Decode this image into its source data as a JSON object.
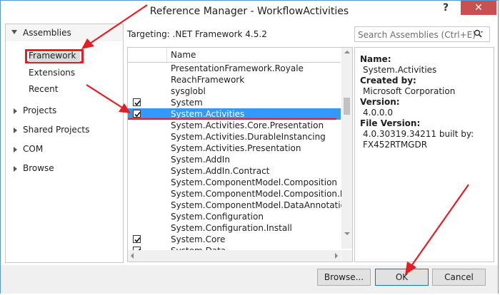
{
  "window": {
    "title": "Reference Manager - WorkflowActivities"
  },
  "titlebar": {
    "help_label": "?",
    "close_label": "✕"
  },
  "sidebar": {
    "header": "Assemblies",
    "sub_items": [
      "Framework",
      "Extensions",
      "Recent"
    ],
    "selected": "Framework",
    "groups": [
      "Projects",
      "Shared Projects",
      "COM",
      "Browse"
    ]
  },
  "targeting": "Targeting: .NET Framework 4.5.2",
  "search": {
    "placeholder": "Search Assemblies (Ctrl+E)"
  },
  "grid": {
    "column_name": "Name",
    "rows": [
      {
        "name": "PresentationFramework.Royale",
        "checked": false,
        "selected": false
      },
      {
        "name": "ReachFramework",
        "checked": false,
        "selected": false
      },
      {
        "name": "sysglobl",
        "checked": false,
        "selected": false
      },
      {
        "name": "System",
        "checked": true,
        "selected": false
      },
      {
        "name": "System.Activities",
        "checked": true,
        "selected": true
      },
      {
        "name": "System.Activities.Core.Presentation",
        "checked": false,
        "selected": false
      },
      {
        "name": "System.Activities.DurableInstancing",
        "checked": false,
        "selected": false
      },
      {
        "name": "System.Activities.Presentation",
        "checked": false,
        "selected": false
      },
      {
        "name": "System.AddIn",
        "checked": false,
        "selected": false
      },
      {
        "name": "System.AddIn.Contract",
        "checked": false,
        "selected": false
      },
      {
        "name": "System.ComponentModel.Composition",
        "checked": false,
        "selected": false
      },
      {
        "name": "System.ComponentModel.Composition.Regis",
        "checked": false,
        "selected": false
      },
      {
        "name": "System.ComponentModel.DataAnnotations",
        "checked": false,
        "selected": false
      },
      {
        "name": "System.Configuration",
        "checked": false,
        "selected": false
      },
      {
        "name": "System.Configuration.Install",
        "checked": false,
        "selected": false
      },
      {
        "name": "System.Core",
        "checked": true,
        "selected": false
      },
      {
        "name": "System.Data",
        "checked": true,
        "selected": false
      }
    ]
  },
  "details": {
    "name_label": "Name:",
    "name_value": "System.Activities",
    "created_label": "Created by:",
    "created_value": "Microsoft Corporation",
    "version_label": "Version:",
    "version_value": "4.0.0.0",
    "file_version_label": "File Version:",
    "file_version_value_1": "4.0.30319.34211 built by:",
    "file_version_value_2": "FX452RTMGDR"
  },
  "buttons": {
    "browse": "Browse...",
    "ok": "OK",
    "cancel": "Cancel"
  },
  "colors": {
    "selection": "#3399ff",
    "annotation": "#e31e24",
    "close": "#c75050"
  }
}
